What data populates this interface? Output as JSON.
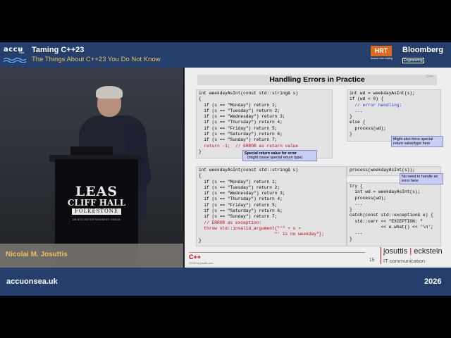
{
  "header": {
    "logo_text": "accu",
    "logo_sub": "On Sea",
    "title": "Taming C++23",
    "subtitle": "The Things About C++23 You Do Not Know",
    "sponsor_hrt": "HRT",
    "sponsor_hrt_sub": "hudson river trading",
    "sponsor_bloomberg": "Bloomberg",
    "sponsor_bloomberg_sub": "Engineering"
  },
  "podium": {
    "line1": "LEAS",
    "line2": "CLIFF HALL",
    "line3": "FOLKESTONE",
    "tagline": "AN ATG ENTERTAINMENT VENUE"
  },
  "speaker": {
    "name": "Nicolai M. Josuttis"
  },
  "slide": {
    "title": "Handling Errors in Practice",
    "corner_tag": "C++",
    "code1": [
      "int weekdayAsInt(const std::string& s)",
      "{",
      "  if (s == \"Monday\") return 1;",
      "  if (s == \"Tuesday\") return 2;",
      "  if (s == \"Wednesday\") return 3;",
      "  if (s == \"Thursday\") return 4;",
      "  if (s == \"Friday\") return 5;",
      "  if (s == \"Saturday\") return 6;",
      "  if (s == \"Sunday\") return 7;",
      "  return -1;  // ERROR as return value",
      "}"
    ],
    "code2": [
      "int wd = weekdayAsInt(s);",
      "if (wd < 0) {",
      "  // error handling:",
      "  ...",
      "}",
      "else {",
      "  process(wd);",
      "}"
    ],
    "code3": [
      "int weekdayAsInt(const std::string& s)",
      "{",
      "  if (s == \"Monday\") return 1;",
      "  if (s == \"Tuesday\") return 2;",
      "  if (s == \"Wednesday\") return 3;",
      "  if (s == \"Thursday\") return 4;",
      "  if (s == \"Friday\") return 5;",
      "  if (s == \"Saturday\") return 6;",
      "  if (s == \"Sunday\") return 7;",
      "  // ERROR as exception:",
      "  throw std::invalid_argument{\"'\" + s +",
      "                             \"' is no weekday\"};",
      "}"
    ],
    "code4a": [
      "process(weekdayAsInt(s));"
    ],
    "code4b": [
      "try {",
      "  int wd = weekdayAsInt(s);",
      "  process(wd);",
      "  ...",
      "}",
      "catch(const std::exception& e) {",
      "  std::cerr << \"EXCEPTION: \"",
      "            << e.what() << '\\n';",
      "  ...",
      "}"
    ],
    "note1_bold": "Special return value for error",
    "note1_sub": "(might cause special return type)",
    "note2": "Might also force special return value/type here",
    "note3": "No need to handle an error here",
    "footer_cpp": "C++",
    "footer_copy": "©2026 by josuttis.com",
    "page_number": "15",
    "brand_left": "josuttis",
    "brand_sep": "|",
    "brand_right": "eckstein",
    "brand_sub": "IT communication"
  },
  "footer": {
    "site": "accuonsea.uk",
    "year": "2026"
  }
}
